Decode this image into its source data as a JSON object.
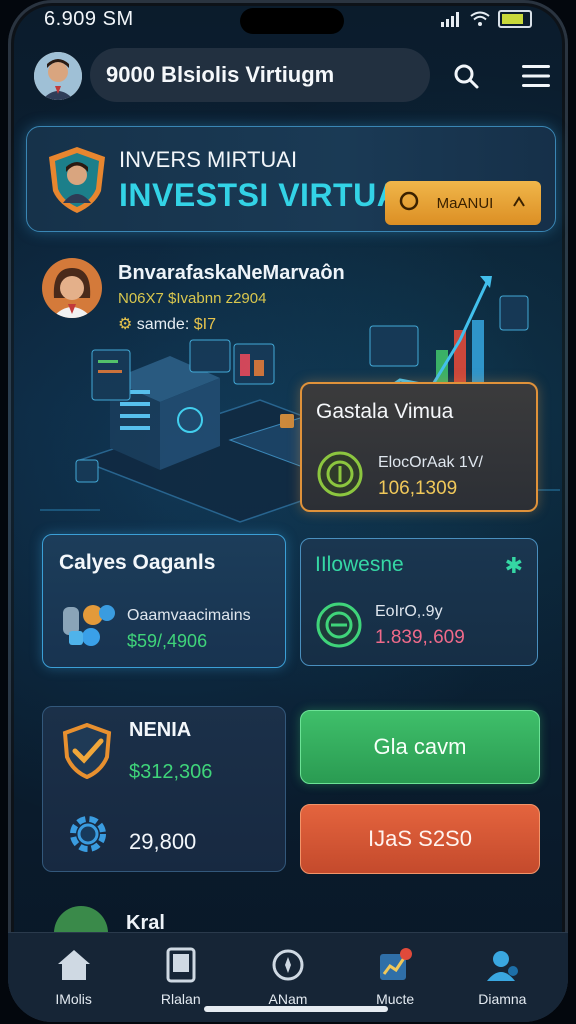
{
  "status_bar": {
    "time": "6.909 SM"
  },
  "header": {
    "search_text": "9000 Blsiolis Virtiugm"
  },
  "banner": {
    "title_small": "INVERS MIRTUAI",
    "title_large": "INVESTSI VIRTUAL",
    "manage_label": "MaANUI"
  },
  "profile": {
    "name": "BnvarafaskaNeMarvaôn",
    "subtitle": "N06X7 $Ivabnn z2904",
    "line_prefix": "samde:",
    "line_amount": "$I7"
  },
  "cards": {
    "orange": {
      "title": "Gastala Vimua",
      "label": "ElocOrAak 1V/",
      "value": "106,1309"
    },
    "blue_left": {
      "title": "Calyes Oaganls",
      "label": "Oaamvaacimains",
      "value": "$59/,4906"
    },
    "blue_right": {
      "title": "IIlowesne",
      "label": "EoIrO,.9y",
      "value": "1.839,.609"
    },
    "navy": {
      "title": "NENIA",
      "value1": "$312,306",
      "value2": "29,800"
    }
  },
  "buttons": {
    "green": "Gla cavm",
    "red": "IJaS S2S0"
  },
  "bottom_peek": "Kral",
  "nav": [
    {
      "label": "IMolis",
      "icon": "home-icon"
    },
    {
      "label": "Rlalan",
      "icon": "tablet-icon"
    },
    {
      "label": "ANam",
      "icon": "compass-icon"
    },
    {
      "label": "Mucte",
      "icon": "chart-badge-icon"
    },
    {
      "label": "Diamna",
      "icon": "person-icon"
    }
  ],
  "colors": {
    "accent_cyan": "#33d3e6",
    "accent_orange": "#e0923a",
    "green": "#3fd47a",
    "red": "#e4643e"
  }
}
